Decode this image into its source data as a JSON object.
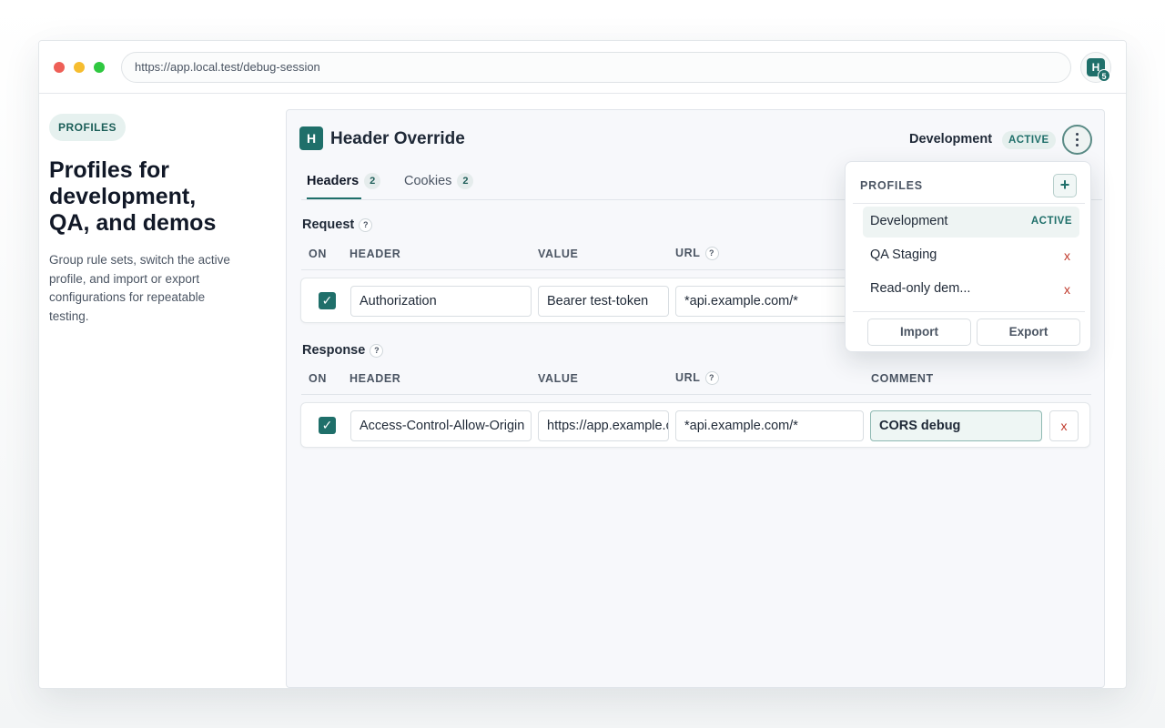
{
  "browser": {
    "url": "https://app.local.test/debug-session",
    "extension": {
      "logo": "H",
      "badge": "5"
    }
  },
  "intro": {
    "pill": "PROFILES",
    "title": "Profiles for development, QA, and demos",
    "description": "Group rule sets, switch the active profile, and import or export configurations for repeatable testing."
  },
  "panel": {
    "logo": "H",
    "title": "Header Override",
    "active_profile": "Development",
    "active_tag": "ACTIVE",
    "tabs": [
      {
        "label": "Headers",
        "count": "2"
      },
      {
        "label": "Cookies",
        "count": "2"
      }
    ],
    "request": {
      "title": "Request",
      "help": "?",
      "columns": {
        "on": "ON",
        "header": "HEADER",
        "value": "VALUE",
        "url": "URL"
      },
      "rows": [
        {
          "header": "Authorization",
          "value": "Bearer test-token",
          "url": "*api.example.com/*"
        }
      ]
    },
    "response": {
      "title": "Response",
      "help": "?",
      "columns": {
        "on": "ON",
        "header": "HEADER",
        "value": "VALUE",
        "url": "URL",
        "comment": "COMMENT"
      },
      "rows": [
        {
          "header": "Access-Control-Allow-Origin",
          "value": "https://app.example.com",
          "url": "*api.example.com/*",
          "comment": "CORS debug",
          "delete": "x"
        }
      ]
    }
  },
  "profiles_menu": {
    "title": "PROFILES",
    "add": "+",
    "items": [
      {
        "label": "Development",
        "tag": "ACTIVE"
      },
      {
        "label": "QA Staging",
        "delete": "x"
      },
      {
        "label": "Read-only dem...",
        "delete": "x"
      }
    ],
    "import_label": "Import",
    "export_label": "Export"
  },
  "colors": {
    "brand": "#1f6f6a",
    "danger": "#c0392b"
  }
}
